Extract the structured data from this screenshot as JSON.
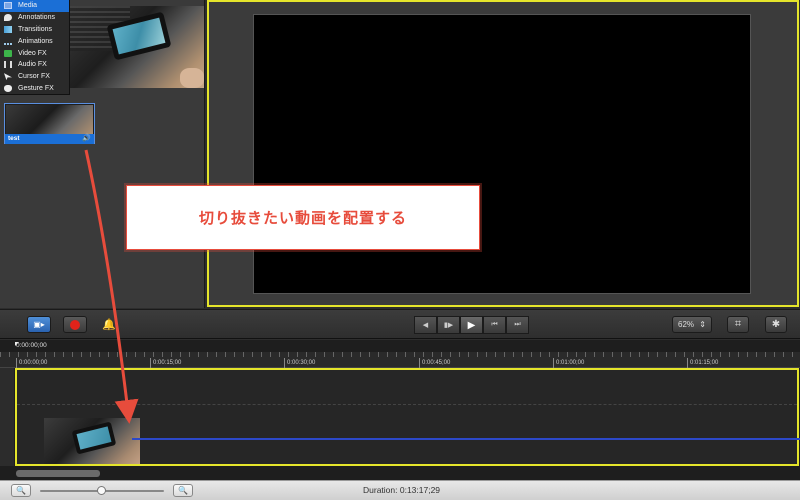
{
  "menu": {
    "items": [
      {
        "label": "Media",
        "icon": "media-icon",
        "selected": true
      },
      {
        "label": "Annotations",
        "icon": "annotations-icon"
      },
      {
        "label": "Transitions",
        "icon": "transitions-icon"
      },
      {
        "label": "Animations",
        "icon": "animations-icon"
      },
      {
        "label": "Video FX",
        "icon": "video-fx-icon"
      },
      {
        "label": "Audio FX",
        "icon": "audio-fx-icon"
      },
      {
        "label": "Cursor FX",
        "icon": "cursor-fx-icon"
      },
      {
        "label": "Gesture FX",
        "icon": "gesture-fx-icon"
      }
    ]
  },
  "media": {
    "clip_name": "test",
    "clip_audio_icon": "speaker-icon"
  },
  "callout": {
    "text": "切り抜きたい動画を配置する",
    "color": "#e74c3c"
  },
  "toolbar": {
    "zoom_level": "62%",
    "transport": [
      "◀",
      "▮▶",
      "▶",
      "⏮",
      "⏭"
    ]
  },
  "timeline": {
    "playhead_time": "0:00:00;00",
    "ticks": [
      "0:00:00;00",
      "0:00:15;00",
      "0:00:30;00",
      "0:00:45;00",
      "0:01:00;00",
      "0:01:15;00"
    ],
    "highlight_color": "#e5e52b",
    "audio_color": "#2c48c8"
  },
  "status": {
    "duration": "Duration: 0:13:17;29"
  },
  "colors": {
    "selection_blue": "#1b6fd6",
    "record_red": "#e2231a"
  }
}
